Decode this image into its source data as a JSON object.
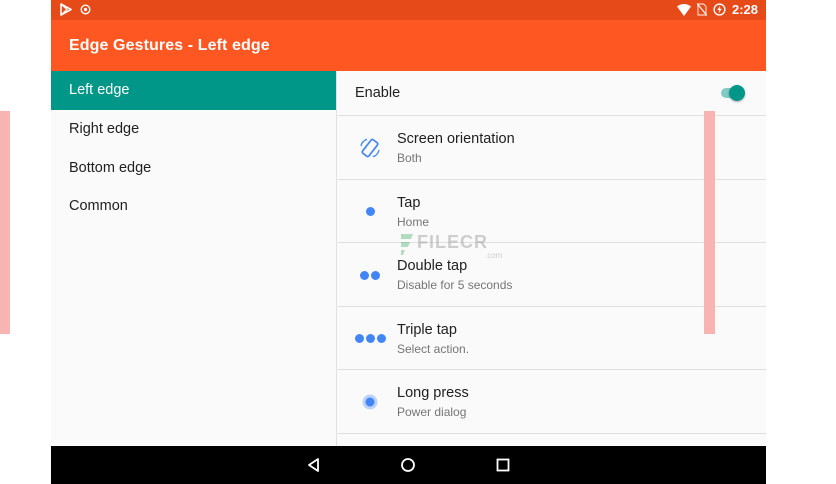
{
  "status_bar": {
    "time": "2:28",
    "left_icons": [
      "play-store-icon",
      "target-icon"
    ],
    "right_icons": [
      "wifi-icon",
      "no-sim-icon",
      "battery-charging-icon"
    ]
  },
  "app_bar": {
    "title": "Edge Gestures - Left edge"
  },
  "sidebar": {
    "items": [
      {
        "label": "Left edge",
        "active": true
      },
      {
        "label": "Right edge",
        "active": false
      },
      {
        "label": "Bottom edge",
        "active": false
      },
      {
        "label": "Common",
        "active": false
      }
    ]
  },
  "enable": {
    "label": "Enable",
    "value": true
  },
  "gestures": [
    {
      "title": "Screen orientation",
      "subtitle": "Both",
      "icon": "screen-rotation-icon"
    },
    {
      "title": "Tap",
      "subtitle": "Home",
      "icon": "single-dot-icon"
    },
    {
      "title": "Double tap",
      "subtitle": "Disable for 5 seconds",
      "icon": "double-dot-icon"
    },
    {
      "title": "Triple tap",
      "subtitle": "Select action.",
      "icon": "triple-dot-icon"
    },
    {
      "title": "Long press",
      "subtitle": "Power dialog",
      "icon": "ring-dot-icon"
    }
  ],
  "watermark": {
    "name": "FILECR",
    "suffix": ".com"
  },
  "colors": {
    "status_bar": "#e64a19",
    "app_bar": "#ff5722",
    "accent": "#009688",
    "gesture_icon": "#4285f4",
    "edge_highlight": "#f8b3b3"
  },
  "nav_bar": {
    "buttons": [
      "back-icon",
      "home-icon",
      "recents-icon"
    ]
  }
}
